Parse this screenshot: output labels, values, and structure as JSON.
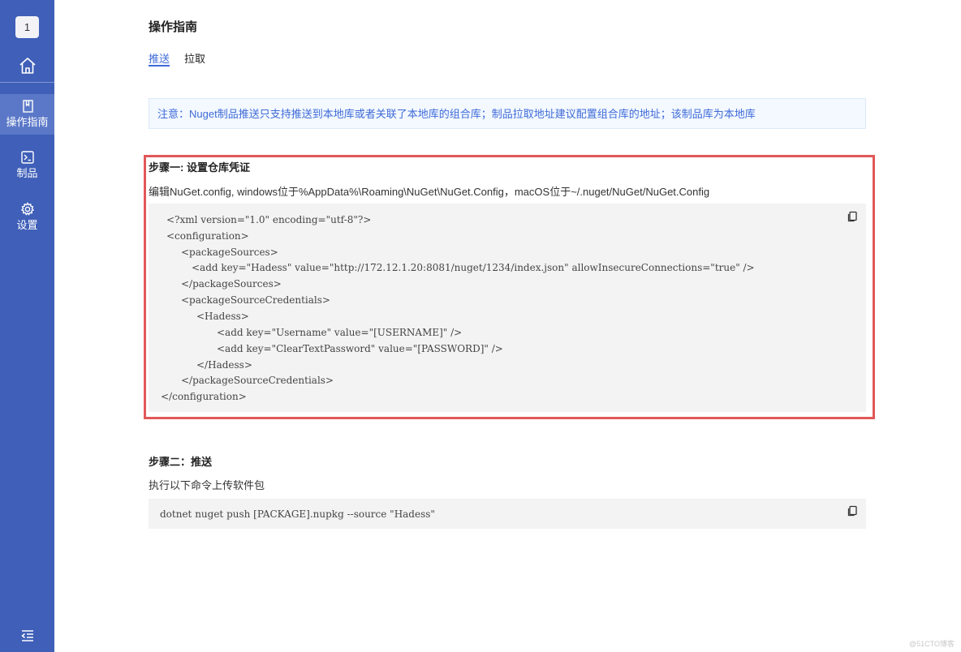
{
  "sidebar": {
    "badge": "1",
    "nav": [
      {
        "label": "操作指南",
        "icon": "book-icon",
        "active": true
      },
      {
        "label": "制品",
        "icon": "terminal-icon",
        "active": false
      },
      {
        "label": "设置",
        "icon": "gear-icon",
        "active": false
      }
    ],
    "collapse_icon": "menu-collapse-icon"
  },
  "page": {
    "title": "操作指南",
    "tabs": [
      {
        "label": "推送",
        "active": true
      },
      {
        "label": "拉取",
        "active": false
      }
    ]
  },
  "notice": "注意：Nuget制品推送只支持推送到本地库或者关联了本地库的组合库；制品拉取地址建议配置组合库的地址；该制品库为本地库",
  "step1": {
    "title": "步骤一: 设置仓库凭证",
    "desc": "编辑NuGet.config, windows位于%AppData%\\Roaming\\NuGet\\NuGet.Config，macOS位于~/.nuget/NuGet/NuGet.Config",
    "code": [
      "<?xml version=\"1.0\" encoding=\"utf-8\"?>",
      "<configuration>",
      "<packageSources>",
      "<add key=\"Hadess\" value=\"http://172.12.1.20:8081/nuget/1234/index.json\" allowInsecureConnections=\"true\" />",
      "</packageSources>",
      "<packageSourceCredentials>",
      "<Hadess>",
      "<add key=\"Username\" value=\"[USERNAME]\" />",
      "<add key=\"ClearTextPassword\" value=\"[PASSWORD]\" />",
      "</Hadess>",
      "</packageSourceCredentials>",
      "</configuration>"
    ]
  },
  "step2": {
    "title": "步骤二：推送",
    "desc": "执行以下命令上传软件包",
    "code": "dotnet nuget push [PACKAGE].nupkg --source \"Hadess\""
  },
  "watermark": "@51CTO博客",
  "colors": {
    "sidebar": "#3f5fb8",
    "accent": "#3f6ad8",
    "highlight": "#e25858"
  }
}
